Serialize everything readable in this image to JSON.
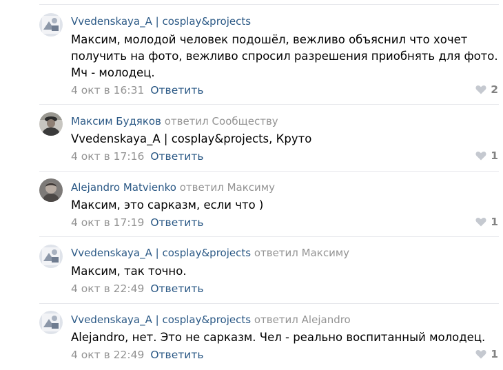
{
  "colors": {
    "link": "#2a5885",
    "muted": "#939393",
    "like_icon": "#c5c9d0",
    "divider": "#e7e8ec"
  },
  "reply_label": "Ответить",
  "comments": [
    {
      "author": "Vvedenskaya_A | cosplay&projects",
      "reply_prefix": "",
      "reply_target": "",
      "text": "Максим, молодой человек подошёл, вежливо объяснил что хочет получить на фото, вежливо спросил разрешения приобнять для фото. Мч - молодец.",
      "date": "4 окт в 16:31",
      "likes": "2",
      "avatar_icon": "user-avatar-icon"
    },
    {
      "author": "Максим Будяков",
      "reply_prefix": "ответил",
      "reply_target": "Сообществу",
      "text": "Vvedenskaya_A | cosplay&projects, Круто",
      "date": "4 окт в 17:16",
      "likes": "1",
      "avatar_icon": "user-avatar-icon"
    },
    {
      "author": "Alejandro Matvienko",
      "reply_prefix": "ответил",
      "reply_target": "Максиму",
      "text": "Максим, это сарказм, если что )",
      "date": "4 окт в 17:19",
      "likes": "1",
      "avatar_icon": "user-avatar-icon"
    },
    {
      "author": "Vvedenskaya_A | cosplay&projects",
      "reply_prefix": "ответил",
      "reply_target": "Максиму",
      "text": "Максим, так точно.",
      "date": "4 окт в 22:49",
      "likes": "",
      "avatar_icon": "user-avatar-icon"
    },
    {
      "author": "Vvedenskaya_A | cosplay&projects",
      "reply_prefix": "ответил",
      "reply_target": "Alejandro",
      "text": "Alejandro, нет. Это не сарказм. Чел - реально воспитанный молодец.",
      "date": "4 окт в 22:49",
      "likes": "1",
      "avatar_icon": "user-avatar-icon"
    }
  ]
}
